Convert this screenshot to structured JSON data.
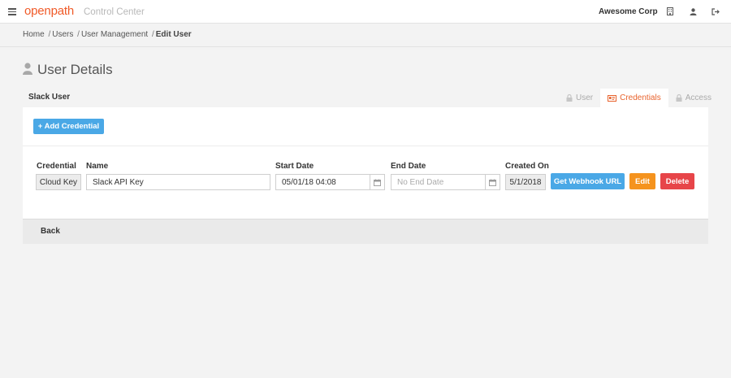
{
  "header": {
    "logo": "openpath",
    "app_title": "Control Center",
    "org_name": "Awesome Corp"
  },
  "icons": {
    "menu": "hamburger-icon",
    "building": "building-icon",
    "user": "user-icon",
    "logout": "sign-out-icon",
    "calendar": "calendar-icon"
  },
  "breadcrumb": {
    "home": "Home",
    "users": "Users",
    "user_management": "User Management",
    "current": "Edit User",
    "separator": "/"
  },
  "page": {
    "title": "User Details",
    "user_label": "Slack User"
  },
  "tabs": [
    {
      "label": "User",
      "active": false
    },
    {
      "label": "Credentials",
      "active": true
    },
    {
      "label": "Access",
      "active": false
    }
  ],
  "actions": {
    "add_credential": "+ Add Credential"
  },
  "columns": {
    "credential": "Credential",
    "name": "Name",
    "start_date": "Start Date",
    "end_date": "End Date",
    "created_on": "Created On"
  },
  "credential_row": {
    "type": "Cloud Key",
    "name": "Slack API Key",
    "start_date": "05/01/18 04:08",
    "end_date_placeholder": "No End Date",
    "created_on": "5/1/2018",
    "webhook_label": "Get Webhook URL",
    "edit_label": "Edit",
    "delete_label": "Delete"
  },
  "footer": {
    "back_label": "Back"
  },
  "colors": {
    "brand": "#f05a28",
    "primary_button": "#4aa8e6",
    "edit_button": "#f5931e",
    "delete_button": "#e74549",
    "active_tab": "#e8632d"
  }
}
